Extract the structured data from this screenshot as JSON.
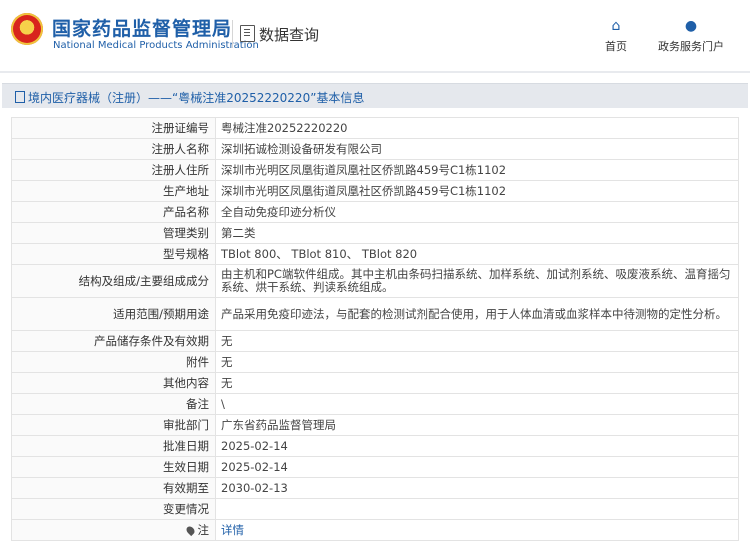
{
  "header": {
    "title_cn": "国家药品监督管理局",
    "title_en": "National Medical Products Administration",
    "query_label": "数据查询",
    "nav": [
      {
        "label": "首页",
        "icon": "home-icon"
      },
      {
        "label": "政务服务门户",
        "icon": "user-icon"
      }
    ]
  },
  "breadcrumb": {
    "text": "境内医疗器械（注册）——“粤械注准20252220220”基本信息"
  },
  "rows": [
    {
      "key": "注册证编号",
      "value": "粤械注准20252220220"
    },
    {
      "key": "注册人名称",
      "value": "深圳拓诚检测设备研发有限公司"
    },
    {
      "key": "注册人住所",
      "value": "深圳市光明区凤凰街道凤凰社区侨凯路459号C1栋1102"
    },
    {
      "key": "生产地址",
      "value": "深圳市光明区凤凰街道凤凰社区侨凯路459号C1栋1102"
    },
    {
      "key": "产品名称",
      "value": "全自动免疫印迹分析仪"
    },
    {
      "key": "管理类别",
      "value": "第二类"
    },
    {
      "key": "型号规格",
      "value": "TBlot 800、 TBlot 810、 TBlot 820"
    },
    {
      "key": "结构及组成/主要组成成分",
      "value": "由主机和PC端软件组成。其中主机由条码扫描系统、加样系统、加试剂系统、吸废液系统、温育摇匀系统、烘干系统、判读系统组成。"
    },
    {
      "key": "适用范围/预期用途",
      "value": "产品采用免疫印迹法，与配套的检测试剂配合使用，用于人体血清或血浆样本中待测物的定性分析。"
    },
    {
      "key": "产品储存条件及有效期",
      "value": "无"
    },
    {
      "key": "附件",
      "value": "无"
    },
    {
      "key": "其他内容",
      "value": "无"
    },
    {
      "key": "备注",
      "value": "\\"
    },
    {
      "key": "审批部门",
      "value": "广东省药品监督管理局"
    },
    {
      "key": "批准日期",
      "value": "2025-02-14"
    },
    {
      "key": "生效日期",
      "value": "2025-02-14"
    },
    {
      "key": "有效期至",
      "value": "2030-02-13"
    },
    {
      "key": "变更情况",
      "value": ""
    },
    {
      "key": "注",
      "value": "详情"
    }
  ]
}
